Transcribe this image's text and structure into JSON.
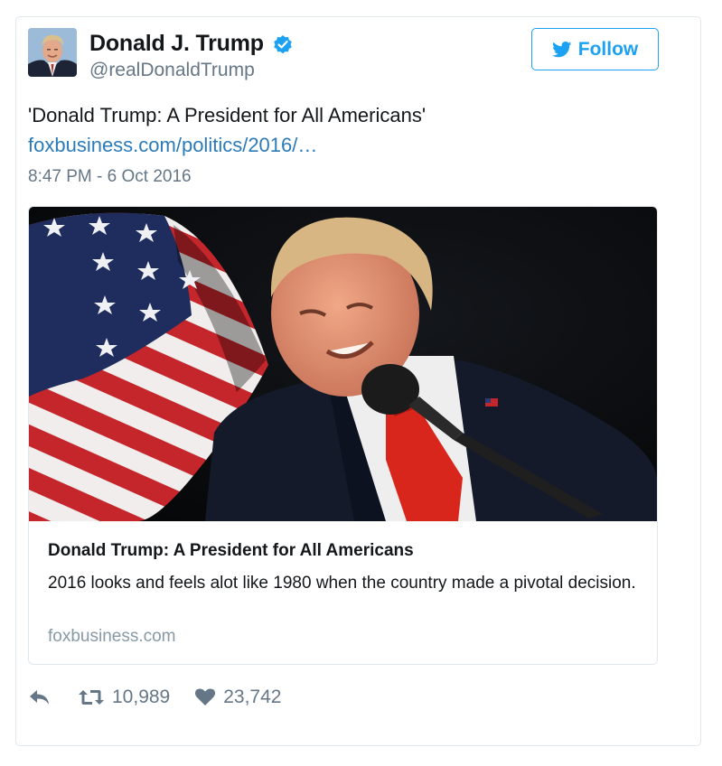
{
  "author": {
    "name": "Donald J. Trump",
    "handle": "@realDonaldTrump",
    "verified": true,
    "avatar_icon": "profile-photo"
  },
  "follow_button": {
    "label": "Follow",
    "icon": "twitter-bird-icon"
  },
  "tweet": {
    "text": "'Donald Trump: A President for All Americans'",
    "link_text": "foxbusiness.com/politics/2016/…",
    "timestamp": "8:47 PM - 6 Oct 2016"
  },
  "link_card": {
    "title": "Donald Trump: A President for All Americans",
    "description": "2016 looks and feels alot like 1980 when the country made a pivotal decision.",
    "domain": "foxbusiness.com"
  },
  "actions": {
    "reply_icon": "reply-icon",
    "retweet_icon": "retweet-icon",
    "retweet_count": "10,989",
    "like_icon": "heart-icon",
    "like_count": "23,742"
  },
  "colors": {
    "accent": "#1da1f2",
    "link": "#2b7bb9",
    "muted": "#657786",
    "border": "#e1e8ed",
    "tie_red": "#d9261c"
  }
}
